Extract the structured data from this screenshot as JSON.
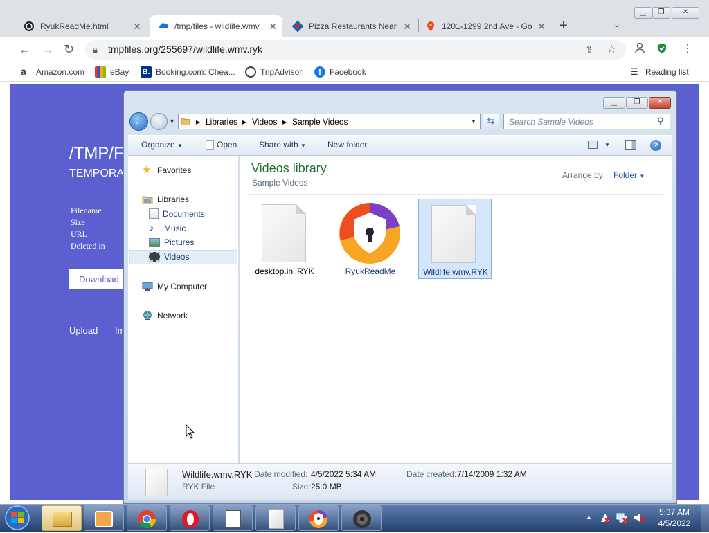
{
  "browser": {
    "tabs": [
      {
        "title": "RyukReadMe.html",
        "active": false
      },
      {
        "title": "/tmp/files - wildlife.wmv",
        "active": true
      },
      {
        "title": "Pizza Restaurants Near M",
        "active": false
      },
      {
        "title": "1201-1299 2nd Ave - Go",
        "active": false
      }
    ],
    "new_tab": "+",
    "url": "tmpfiles.org/255697/wildlife.wmv.ryk",
    "bookmarks": [
      {
        "label": "Amazon.com",
        "icon": "amazon-icon"
      },
      {
        "label": "eBay",
        "icon": "ebay-icon"
      },
      {
        "label": "Booking.com: Chea...",
        "icon": "booking-icon"
      },
      {
        "label": "TripAdvisor",
        "icon": "tripadvisor-icon"
      },
      {
        "label": "Facebook",
        "icon": "facebook-icon"
      }
    ],
    "reading_list": "Reading list"
  },
  "webpage": {
    "title": "/TMP/F",
    "subtitle": "TEMPORA",
    "labels": [
      "Filename",
      "Size",
      "URL",
      "Deleted in"
    ],
    "download": "Download",
    "footer": [
      "Upload",
      "Im"
    ],
    "bg_color": "#5b5fd0"
  },
  "explorer": {
    "breadcrumb": [
      "Libraries",
      "Videos",
      "Sample Videos"
    ],
    "search_placeholder": "Search Sample Videos",
    "commands": {
      "organize": "Organize",
      "open": "Open",
      "share_with": "Share with",
      "new_folder": "New folder"
    },
    "nav": {
      "favorites": "Favorites",
      "libraries": "Libraries",
      "library_items": [
        "Documents",
        "Music",
        "Pictures",
        "Videos"
      ],
      "my_computer": "My Computer",
      "network": "Network"
    },
    "library_title": "Videos library",
    "library_sub": "Sample Videos",
    "arrange_label": "Arrange by:",
    "arrange_value": "Folder",
    "files": [
      {
        "name": "desktop.ini.RYK",
        "icon": "document-icon",
        "selected": false
      },
      {
        "name": "RyukReadMe",
        "icon": "avast-browser-icon",
        "selected": false
      },
      {
        "name": "Wildlife.wmv.RYK",
        "icon": "document-icon",
        "selected": true
      }
    ],
    "details": {
      "name": "Wildlife.wmv.RYK",
      "type": "RYK File",
      "date_modified_label": "Date modified:",
      "date_modified": "4/5/2022 5:34 AM",
      "size_label": "Size:",
      "size": "25.0 MB",
      "date_created_label": "Date created:",
      "date_created": "7/14/2009 1:32 AM"
    }
  },
  "taskbar": {
    "time": "5:37 AM",
    "date": "4/5/2022"
  }
}
